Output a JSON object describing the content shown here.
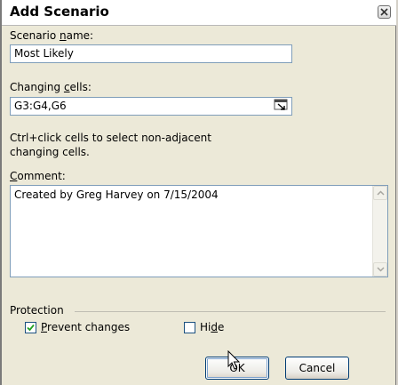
{
  "dialog": {
    "title": "Add Scenario",
    "close_icon": "close-icon"
  },
  "scenario_name": {
    "label_pre": "Scenario ",
    "label_accel": "n",
    "label_post": "ame:",
    "value": "Most Likely"
  },
  "changing_cells": {
    "label_pre": "Changing ",
    "label_accel": "c",
    "label_post": "ells:",
    "value": "G3:G4,G6",
    "collapse_icon": "collapse-dialog-icon"
  },
  "hint": {
    "line1": "Ctrl+click cells to select non-adjacent",
    "line2": "changing cells."
  },
  "comment": {
    "label_pre": "",
    "label_accel": "C",
    "label_post": "omment:",
    "value": "Created by Greg Harvey on 7/15/2004"
  },
  "protection": {
    "heading": "Protection",
    "prevent_changes": {
      "label_accel": "P",
      "label_rest": "revent changes",
      "checked": true
    },
    "hide": {
      "label_pre": "Hi",
      "label_accel": "d",
      "label_post": "e",
      "checked": false
    }
  },
  "buttons": {
    "ok": "OK",
    "cancel": "Cancel"
  },
  "colors": {
    "dialog_bg": "#ece9d8",
    "field_border": "#7f9db9",
    "button_border": "#003c74"
  }
}
